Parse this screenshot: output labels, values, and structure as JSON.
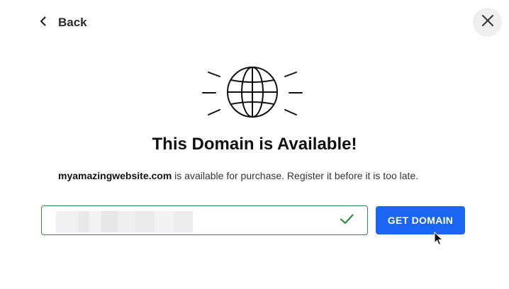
{
  "nav": {
    "back_label": "Back"
  },
  "icons": {
    "back": "chevron-left-icon",
    "close": "close-icon",
    "hero": "globe-icon",
    "status": "check-icon"
  },
  "heading": {
    "title": "This Domain is Available!"
  },
  "message": {
    "domain": "myamazingwebsite.com",
    "text": " is available for purchase. Register it before it is too late."
  },
  "search": {
    "value": "",
    "status": "valid"
  },
  "actions": {
    "get_domain_label": "GET DOMAIN"
  },
  "colors": {
    "accent": "#1a66f2",
    "success": "#2e8b3e",
    "close_bg": "#efefef"
  }
}
